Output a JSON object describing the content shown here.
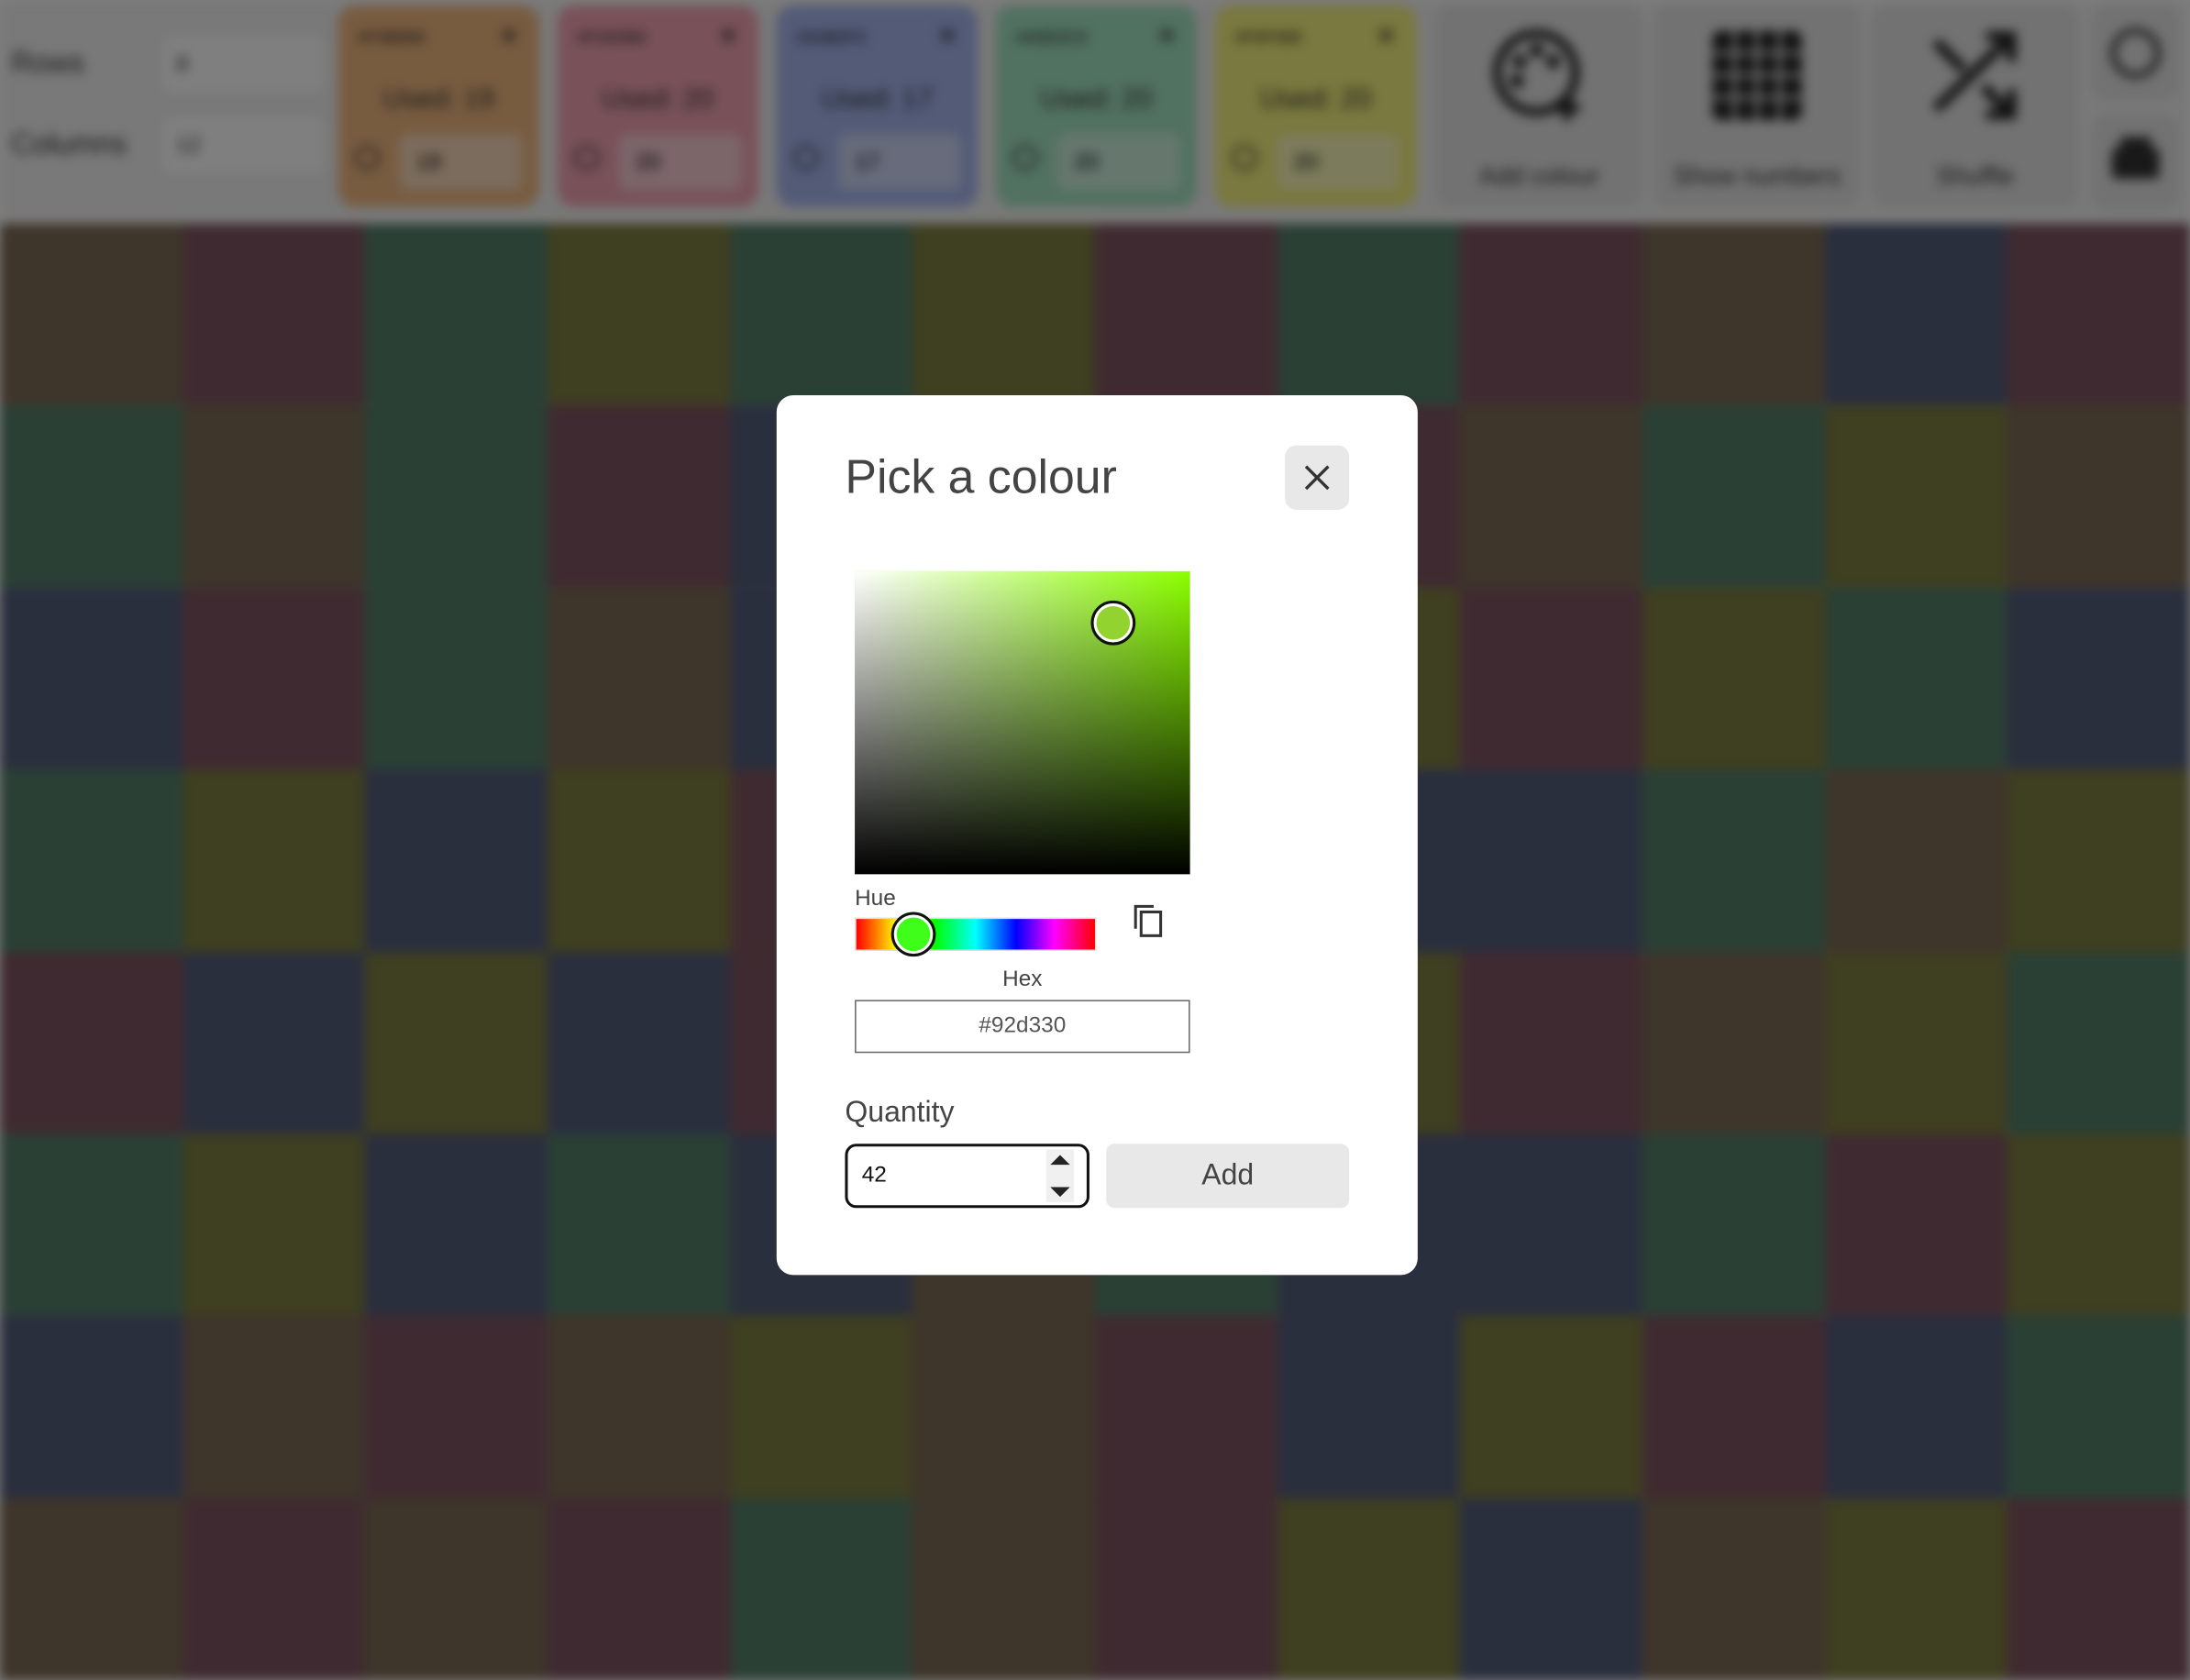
{
  "toolbar": {
    "rows_label": "Rows",
    "rows_value": "8",
    "columns_label": "Columns",
    "columns_value": "12",
    "swatches": [
      {
        "hex": "#F0B880",
        "used_label": "Used: 19",
        "qty": "19",
        "color": "#f0b881"
      },
      {
        "hex": "#F0A0B0",
        "used_label": "Used: 20",
        "qty": "20",
        "color": "#f2a3b3"
      },
      {
        "hex": "#A0B0F0",
        "used_label": "Used: 17",
        "qty": "17",
        "color": "#a6b6ef"
      },
      {
        "hex": "#A0E0C0",
        "used_label": "Used: 20",
        "qty": "20",
        "color": "#a3e3c2"
      },
      {
        "hex": "#F0F080",
        "used_label": "Used: 20",
        "qty": "20",
        "color": "#f4f27e"
      }
    ],
    "tools": [
      {
        "label": "Add colour",
        "icon": "palette-plus-icon"
      },
      {
        "label": "Show numbers",
        "icon": "grid-icon"
      },
      {
        "label": "Shuffle",
        "icon": "shuffle-icon"
      }
    ],
    "side_icons": [
      "info-icon",
      "print-icon"
    ]
  },
  "grid": {
    "rows": 8,
    "cols": 12,
    "palette": {
      "o": "#7d6b56",
      "p": "#7f5562",
      "g": "#55806a",
      "y": "#7e7e42",
      "b": "#555e7c"
    },
    "cells": [
      "opgygypgpobp",
      "gogpbgypogyo",
      "bpgobgyypygb",
      "gybyppbbbgoy",
      "pbybpgoypoyg",
      "gybgbogbbgpy",
      "bopoyopbypbg",
      "opopgopyboyp"
    ]
  },
  "modal": {
    "title": "Pick a colour",
    "close_icon": "close-icon",
    "hue_label": "Hue",
    "hex_label": "Hex",
    "hex_value": "#92d330",
    "quantity_label": "Quantity",
    "quantity_value": "42",
    "add_label": "Add",
    "copy_icon": "copy-icon",
    "selected_color": "#92d330",
    "hue_fraction": 0.24
  }
}
